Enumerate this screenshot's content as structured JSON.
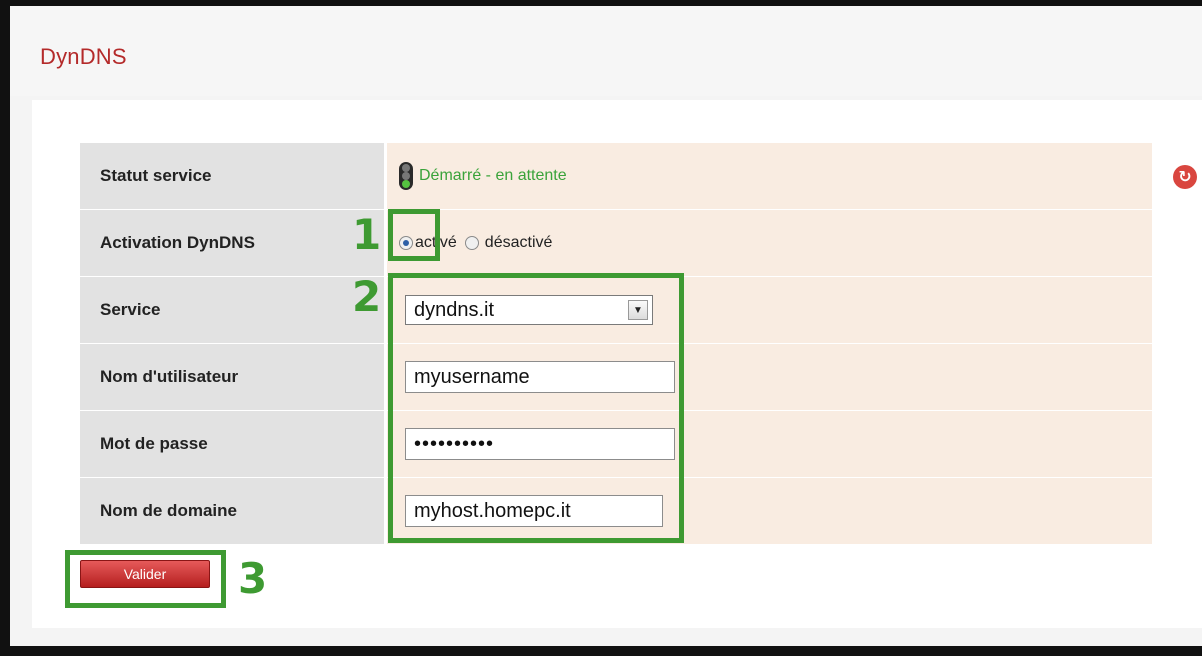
{
  "page": {
    "title": "DynDNS"
  },
  "status": {
    "label": "Statut service",
    "value": "Démarré - en attente"
  },
  "activation": {
    "label": "Activation DynDNS",
    "options": [
      {
        "label": "activé",
        "checked": true
      },
      {
        "label": "désactivé",
        "checked": false
      }
    ]
  },
  "service": {
    "label": "Service",
    "selected": "dyndns.it"
  },
  "username": {
    "label": "Nom d'utilisateur",
    "value": "myusername"
  },
  "password": {
    "label": "Mot de passe",
    "value": "••••••••••"
  },
  "domain": {
    "label": "Nom de domaine",
    "value": "myhost.homepc.it"
  },
  "submit": {
    "label": "Valider"
  },
  "annotations": {
    "one": "1",
    "two": "2",
    "three": "3"
  },
  "colors": {
    "title": "#b42a2a",
    "status": "#3aa33a",
    "annotation": "#3e9a32",
    "button": "#c8302f",
    "value_bg": "#f9ece1",
    "label_bg": "#e2e2e2"
  }
}
